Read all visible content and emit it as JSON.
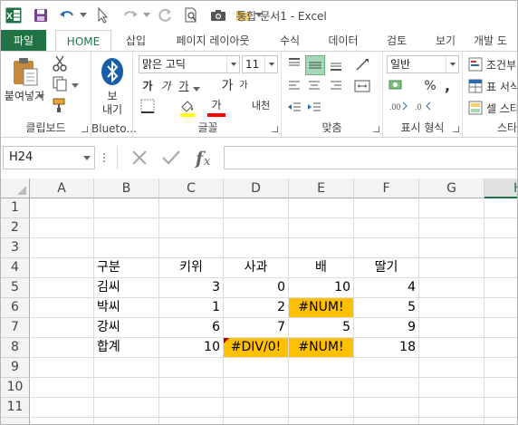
{
  "app": {
    "title": "통합 문서1 - Excel"
  },
  "tabs": [
    {
      "label": "파일"
    },
    {
      "label": "HOME"
    },
    {
      "label": "삽입"
    },
    {
      "label": "페이지 레이아웃"
    },
    {
      "label": "수식"
    },
    {
      "label": "데이터"
    },
    {
      "label": "검토"
    },
    {
      "label": "보기"
    },
    {
      "label": "개발 도"
    }
  ],
  "ribbon": {
    "clipboard": {
      "paste_label": "붙여넣기",
      "group_label": "클립보드"
    },
    "bluetooth": {
      "send_label_1": "보",
      "send_label_2": "내기",
      "group_label": "Blueto..."
    },
    "font": {
      "font_name": "맑은 고딕",
      "font_size": "11",
      "grow_label": "가",
      "shrink_label": "가",
      "bold_label": "가",
      "italic_label": "가",
      "underline_label": "가",
      "font_color_label": "가",
      "phonetic_label": "내천",
      "group_label": "글꼴"
    },
    "alignment": {
      "group_label": "맞춤"
    },
    "number": {
      "format": "일반",
      "percent": "%",
      "comma": ",",
      "group_label": "표시 형식"
    },
    "styles": {
      "conditional_label": "조건부",
      "table_label": "표 서식",
      "cell_label": "셀 스타",
      "group_label": "스타"
    }
  },
  "formula_bar": {
    "name_box": "H24",
    "formula": ""
  },
  "sheet": {
    "columns": [
      "A",
      "B",
      "C",
      "D",
      "E",
      "F",
      "G",
      "H"
    ],
    "rows": [
      "1",
      "2",
      "3",
      "4",
      "5",
      "6",
      "7",
      "8",
      "9",
      "10",
      "11"
    ],
    "header_row": [
      "구분",
      "키위",
      "사과",
      "배",
      "딸기"
    ],
    "data": [
      {
        "name": "김씨",
        "c": "3",
        "d": "0",
        "e": "10",
        "f": "4"
      },
      {
        "name": "박씨",
        "c": "1",
        "d": "2",
        "e": "#NUM!",
        "f": "5"
      },
      {
        "name": "강씨",
        "c": "6",
        "d": "7",
        "e": "5",
        "f": "9"
      },
      {
        "name": "합계",
        "c": "10",
        "d": "#DIV/0!",
        "e": "#NUM!",
        "f": "18"
      }
    ]
  },
  "colors": {
    "accent": "#217346",
    "error_fill": "#ffc000",
    "error_marker": "#c00000"
  }
}
